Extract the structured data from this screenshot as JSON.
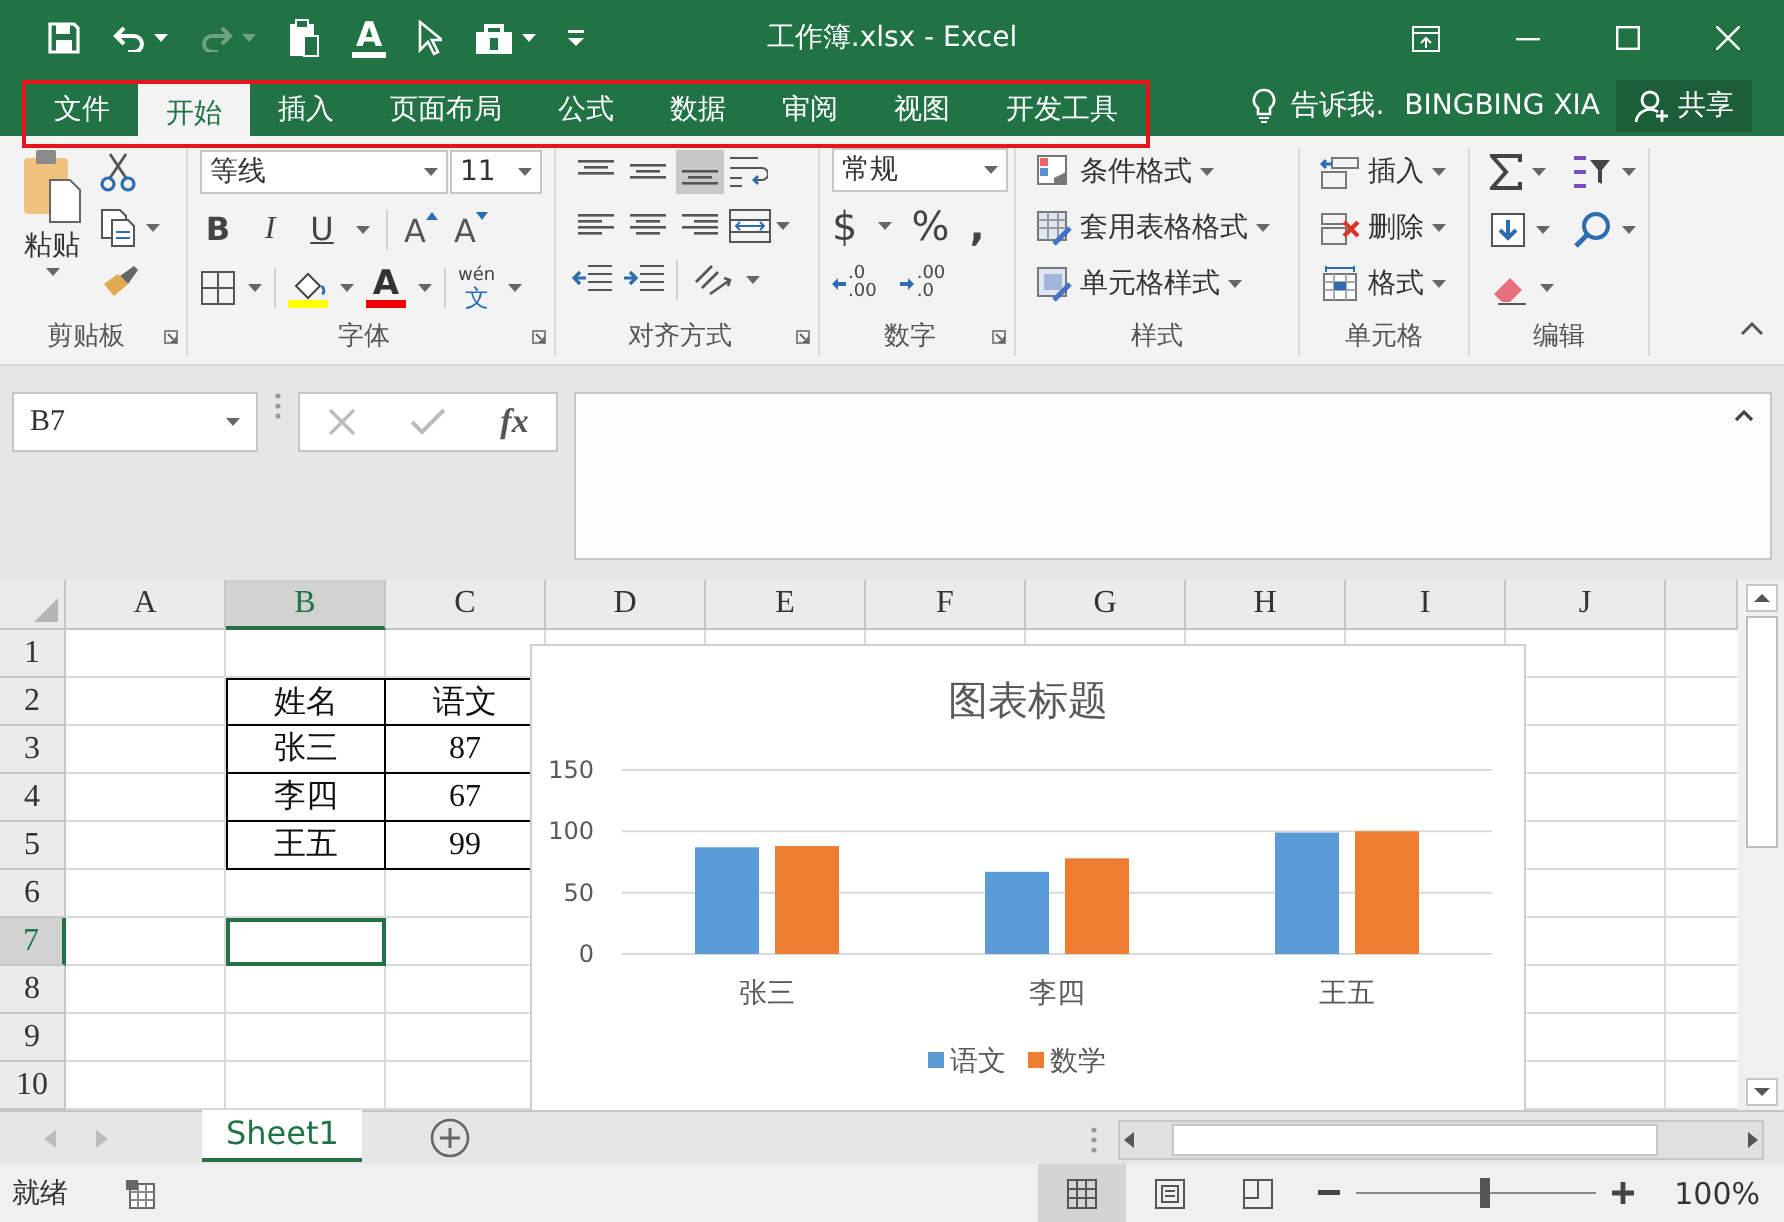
{
  "window": {
    "title": "工作簿.xlsx - Excel"
  },
  "quick_access": {
    "font_color": "A",
    "redo": {
      "disabled": true
    }
  },
  "tabs": [
    {
      "label": "文件",
      "selected": false
    },
    {
      "label": "开始",
      "selected": true
    },
    {
      "label": "插入",
      "selected": false
    },
    {
      "label": "页面布局",
      "selected": false
    },
    {
      "label": "公式",
      "selected": false
    },
    {
      "label": "数据",
      "selected": false
    },
    {
      "label": "审阅",
      "selected": false
    },
    {
      "label": "视图",
      "selected": false
    },
    {
      "label": "开发工具",
      "selected": false
    }
  ],
  "tell_me": "告诉我.",
  "user": "BINGBING XIA",
  "share": "共享",
  "ribbon": {
    "clipboard": {
      "label": "剪贴板",
      "paste": "粘贴"
    },
    "font": {
      "label": "字体",
      "font_name": "等线",
      "font_size": "11",
      "bold": "B",
      "italic": "I",
      "underline": "U",
      "grow_font": "A",
      "shrink_font": "A",
      "font_color": "A",
      "phonetic_reading": "wén",
      "phonetic_char": "文"
    },
    "alignment": {
      "label": "对齐方式",
      "vertical_align": [
        {
          "selected": false
        },
        {
          "selected": false
        },
        {
          "selected": true
        }
      ],
      "horizontal_align": [
        {
          "selected": false
        },
        {
          "selected": false
        },
        {
          "selected": false
        }
      ]
    },
    "number": {
      "label": "数字",
      "format": "常规",
      "currency": "$",
      "percent": "%",
      "comma": ",",
      "increase_decimal": [
        ".0",
        ".00"
      ],
      "decrease_decimal": [
        ".00",
        ".0"
      ]
    },
    "styles": {
      "label": "样式",
      "buttons": [
        "条件格式",
        "套用表格格式",
        "单元格样式"
      ]
    },
    "cells": {
      "label": "单元格",
      "buttons": [
        "插入",
        "删除",
        "格式"
      ]
    },
    "editing": {
      "label": "编辑"
    }
  },
  "formula_bar": {
    "name_box": "B7",
    "insert_function": "fx",
    "cancel": {
      "disabled": true
    },
    "enter": {
      "disabled": true
    }
  },
  "sheet": {
    "columns": [
      {
        "label": "A",
        "selected": false
      },
      {
        "label": "B",
        "selected": true
      },
      {
        "label": "C",
        "selected": false
      },
      {
        "label": "D",
        "selected": false
      },
      {
        "label": "E",
        "selected": false
      },
      {
        "label": "F",
        "selected": false
      },
      {
        "label": "G",
        "selected": false
      },
      {
        "label": "H",
        "selected": false
      },
      {
        "label": "I",
        "selected": false
      },
      {
        "label": "J",
        "selected": false
      }
    ],
    "rows": [
      {
        "label": "1",
        "selected": false
      },
      {
        "label": "2",
        "selected": false
      },
      {
        "label": "3",
        "selected": false
      },
      {
        "label": "4",
        "selected": false
      },
      {
        "label": "5",
        "selected": false
      },
      {
        "label": "6",
        "selected": false
      },
      {
        "label": "7",
        "selected": true
      },
      {
        "label": "8",
        "selected": false
      },
      {
        "label": "9",
        "selected": false
      },
      {
        "label": "10",
        "selected": false
      }
    ],
    "table": {
      "header": [
        "姓名",
        "语文"
      ],
      "rows": [
        [
          "张三",
          "87"
        ],
        [
          "李四",
          "67"
        ],
        [
          "王五",
          "99"
        ]
      ]
    }
  },
  "chart": {
    "chart_data": {
      "type": "bar",
      "title": "图表标题",
      "categories": [
        "张三",
        "李四",
        "王五"
      ],
      "series": [
        {
          "name": "语文",
          "color": "#5b9bd5",
          "values": [
            87,
            67,
            99
          ]
        },
        {
          "name": "数学",
          "color": "#ed7d31",
          "values": [
            88,
            78,
            100
          ]
        }
      ],
      "ylim": [
        0,
        150
      ],
      "yticks": [
        0,
        50,
        100,
        150
      ],
      "legend": "bottom"
    }
  },
  "sheet_tabs": [
    {
      "label": "Sheet1",
      "selected": true
    }
  ],
  "status_bar": {
    "status": "就绪",
    "views": [
      {
        "selected": true
      },
      {
        "selected": false
      },
      {
        "selected": false
      }
    ],
    "zoom": {
      "level": 0.53,
      "reading": "100%"
    }
  }
}
